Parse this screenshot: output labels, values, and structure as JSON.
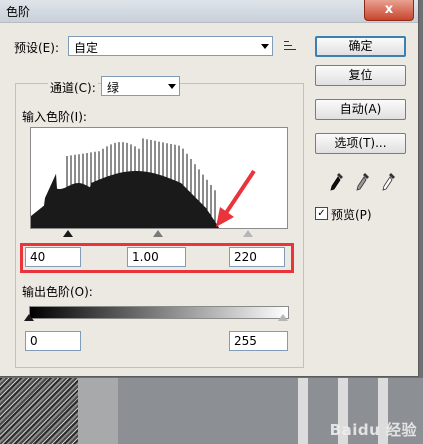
{
  "window": {
    "title": "色阶",
    "close_label": "x"
  },
  "preset": {
    "label": "预设(E):",
    "value": "自定"
  },
  "channel": {
    "label": "通道(C):",
    "value": "绿"
  },
  "input_levels": {
    "label": "输入色阶(I):",
    "black": "40",
    "gamma": "1.00",
    "white": "220"
  },
  "output_levels": {
    "label": "输出色阶(O):",
    "black": "0",
    "white": "255"
  },
  "buttons": {
    "ok": "确定",
    "reset": "复位",
    "auto": "自动(A)",
    "options": "选项(T)..."
  },
  "preview": {
    "label": "预览(P)",
    "checked": true
  },
  "colors": {
    "highlight_box": "#e8343a",
    "default_button_border": "#3c7fb1"
  },
  "watermark": "Baidu 经验"
}
